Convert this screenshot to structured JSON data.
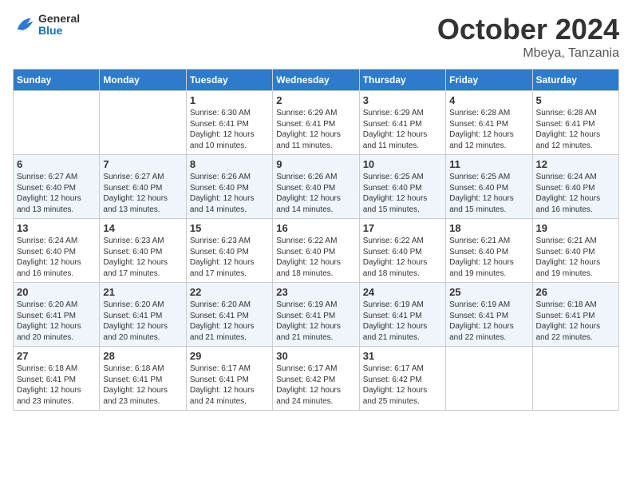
{
  "header": {
    "logo_general": "General",
    "logo_blue": "Blue",
    "month_title": "October 2024",
    "location": "Mbeya, Tanzania"
  },
  "days_of_week": [
    "Sunday",
    "Monday",
    "Tuesday",
    "Wednesday",
    "Thursday",
    "Friday",
    "Saturday"
  ],
  "weeks": [
    [
      {
        "day": "",
        "sunrise": "",
        "sunset": "",
        "daylight": ""
      },
      {
        "day": "",
        "sunrise": "",
        "sunset": "",
        "daylight": ""
      },
      {
        "day": "1",
        "sunrise": "Sunrise: 6:30 AM",
        "sunset": "Sunset: 6:41 PM",
        "daylight": "Daylight: 12 hours and 10 minutes."
      },
      {
        "day": "2",
        "sunrise": "Sunrise: 6:29 AM",
        "sunset": "Sunset: 6:41 PM",
        "daylight": "Daylight: 12 hours and 11 minutes."
      },
      {
        "day": "3",
        "sunrise": "Sunrise: 6:29 AM",
        "sunset": "Sunset: 6:41 PM",
        "daylight": "Daylight: 12 hours and 11 minutes."
      },
      {
        "day": "4",
        "sunrise": "Sunrise: 6:28 AM",
        "sunset": "Sunset: 6:41 PM",
        "daylight": "Daylight: 12 hours and 12 minutes."
      },
      {
        "day": "5",
        "sunrise": "Sunrise: 6:28 AM",
        "sunset": "Sunset: 6:41 PM",
        "daylight": "Daylight: 12 hours and 12 minutes."
      }
    ],
    [
      {
        "day": "6",
        "sunrise": "Sunrise: 6:27 AM",
        "sunset": "Sunset: 6:40 PM",
        "daylight": "Daylight: 12 hours and 13 minutes."
      },
      {
        "day": "7",
        "sunrise": "Sunrise: 6:27 AM",
        "sunset": "Sunset: 6:40 PM",
        "daylight": "Daylight: 12 hours and 13 minutes."
      },
      {
        "day": "8",
        "sunrise": "Sunrise: 6:26 AM",
        "sunset": "Sunset: 6:40 PM",
        "daylight": "Daylight: 12 hours and 14 minutes."
      },
      {
        "day": "9",
        "sunrise": "Sunrise: 6:26 AM",
        "sunset": "Sunset: 6:40 PM",
        "daylight": "Daylight: 12 hours and 14 minutes."
      },
      {
        "day": "10",
        "sunrise": "Sunrise: 6:25 AM",
        "sunset": "Sunset: 6:40 PM",
        "daylight": "Daylight: 12 hours and 15 minutes."
      },
      {
        "day": "11",
        "sunrise": "Sunrise: 6:25 AM",
        "sunset": "Sunset: 6:40 PM",
        "daylight": "Daylight: 12 hours and 15 minutes."
      },
      {
        "day": "12",
        "sunrise": "Sunrise: 6:24 AM",
        "sunset": "Sunset: 6:40 PM",
        "daylight": "Daylight: 12 hours and 16 minutes."
      }
    ],
    [
      {
        "day": "13",
        "sunrise": "Sunrise: 6:24 AM",
        "sunset": "Sunset: 6:40 PM",
        "daylight": "Daylight: 12 hours and 16 minutes."
      },
      {
        "day": "14",
        "sunrise": "Sunrise: 6:23 AM",
        "sunset": "Sunset: 6:40 PM",
        "daylight": "Daylight: 12 hours and 17 minutes."
      },
      {
        "day": "15",
        "sunrise": "Sunrise: 6:23 AM",
        "sunset": "Sunset: 6:40 PM",
        "daylight": "Daylight: 12 hours and 17 minutes."
      },
      {
        "day": "16",
        "sunrise": "Sunrise: 6:22 AM",
        "sunset": "Sunset: 6:40 PM",
        "daylight": "Daylight: 12 hours and 18 minutes."
      },
      {
        "day": "17",
        "sunrise": "Sunrise: 6:22 AM",
        "sunset": "Sunset: 6:40 PM",
        "daylight": "Daylight: 12 hours and 18 minutes."
      },
      {
        "day": "18",
        "sunrise": "Sunrise: 6:21 AM",
        "sunset": "Sunset: 6:40 PM",
        "daylight": "Daylight: 12 hours and 19 minutes."
      },
      {
        "day": "19",
        "sunrise": "Sunrise: 6:21 AM",
        "sunset": "Sunset: 6:40 PM",
        "daylight": "Daylight: 12 hours and 19 minutes."
      }
    ],
    [
      {
        "day": "20",
        "sunrise": "Sunrise: 6:20 AM",
        "sunset": "Sunset: 6:41 PM",
        "daylight": "Daylight: 12 hours and 20 minutes."
      },
      {
        "day": "21",
        "sunrise": "Sunrise: 6:20 AM",
        "sunset": "Sunset: 6:41 PM",
        "daylight": "Daylight: 12 hours and 20 minutes."
      },
      {
        "day": "22",
        "sunrise": "Sunrise: 6:20 AM",
        "sunset": "Sunset: 6:41 PM",
        "daylight": "Daylight: 12 hours and 21 minutes."
      },
      {
        "day": "23",
        "sunrise": "Sunrise: 6:19 AM",
        "sunset": "Sunset: 6:41 PM",
        "daylight": "Daylight: 12 hours and 21 minutes."
      },
      {
        "day": "24",
        "sunrise": "Sunrise: 6:19 AM",
        "sunset": "Sunset: 6:41 PM",
        "daylight": "Daylight: 12 hours and 21 minutes."
      },
      {
        "day": "25",
        "sunrise": "Sunrise: 6:19 AM",
        "sunset": "Sunset: 6:41 PM",
        "daylight": "Daylight: 12 hours and 22 minutes."
      },
      {
        "day": "26",
        "sunrise": "Sunrise: 6:18 AM",
        "sunset": "Sunset: 6:41 PM",
        "daylight": "Daylight: 12 hours and 22 minutes."
      }
    ],
    [
      {
        "day": "27",
        "sunrise": "Sunrise: 6:18 AM",
        "sunset": "Sunset: 6:41 PM",
        "daylight": "Daylight: 12 hours and 23 minutes."
      },
      {
        "day": "28",
        "sunrise": "Sunrise: 6:18 AM",
        "sunset": "Sunset: 6:41 PM",
        "daylight": "Daylight: 12 hours and 23 minutes."
      },
      {
        "day": "29",
        "sunrise": "Sunrise: 6:17 AM",
        "sunset": "Sunset: 6:41 PM",
        "daylight": "Daylight: 12 hours and 24 minutes."
      },
      {
        "day": "30",
        "sunrise": "Sunrise: 6:17 AM",
        "sunset": "Sunset: 6:42 PM",
        "daylight": "Daylight: 12 hours and 24 minutes."
      },
      {
        "day": "31",
        "sunrise": "Sunrise: 6:17 AM",
        "sunset": "Sunset: 6:42 PM",
        "daylight": "Daylight: 12 hours and 25 minutes."
      },
      {
        "day": "",
        "sunrise": "",
        "sunset": "",
        "daylight": ""
      },
      {
        "day": "",
        "sunrise": "",
        "sunset": "",
        "daylight": ""
      }
    ]
  ]
}
